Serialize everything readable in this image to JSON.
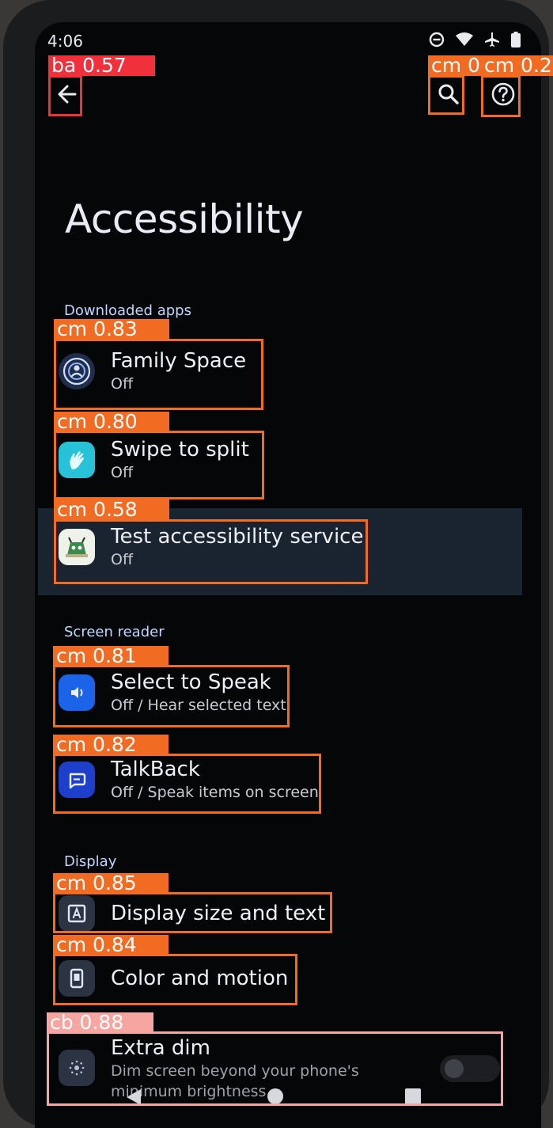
{
  "status_bar": {
    "time": "4:06"
  },
  "page": {
    "title": "Accessibility"
  },
  "sections": {
    "downloaded_apps": "Downloaded apps",
    "screen_reader": "Screen reader",
    "display": "Display"
  },
  "items": {
    "family_space": {
      "title": "Family Space",
      "subtitle": "Off"
    },
    "swipe_to_split": {
      "title": "Swipe to split",
      "subtitle": "Off"
    },
    "test_accessibility": {
      "title": "Test accessibility service",
      "subtitle": "Off"
    },
    "select_to_speak": {
      "title": "Select to Speak",
      "subtitle": "Off / Hear selected text"
    },
    "talkback": {
      "title": "TalkBack",
      "subtitle": "Off / Speak items on screen"
    },
    "display_size": {
      "title": "Display size and text"
    },
    "color_motion": {
      "title": "Color and motion"
    },
    "extra_dim": {
      "title": "Extra dim",
      "subtitle": "Dim screen beyond your phone's minimum brightness",
      "toggle_on": false
    }
  },
  "detections": [
    {
      "label": "ba 0.57"
    },
    {
      "label": "cm 0."
    },
    {
      "label": "cm 0.2"
    },
    {
      "label": "cm 0.83"
    },
    {
      "label": "cm 0.80"
    },
    {
      "label": "cm 0.58"
    },
    {
      "label": "cm 0.81"
    },
    {
      "label": "cm 0.82"
    },
    {
      "label": "cm 0.85"
    },
    {
      "label": "cm 0.84"
    },
    {
      "label": "cb 0.88"
    }
  ],
  "colors": {
    "detection_orange": "#f26b22",
    "detection_red": "#f0303a",
    "detection_pink": "#f7a5a0"
  }
}
